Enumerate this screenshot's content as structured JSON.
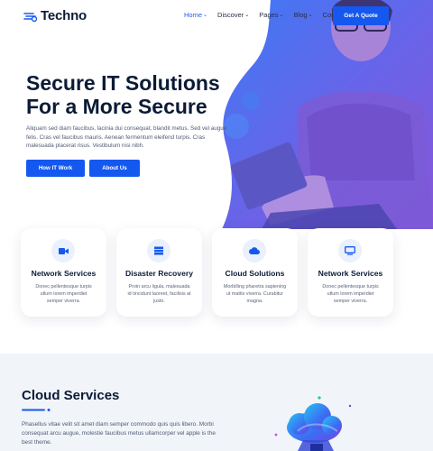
{
  "brand": {
    "name": "Techno",
    "accent": "#1558f0"
  },
  "nav": {
    "items": [
      {
        "label": "Home",
        "caret": "⌄",
        "active": true
      },
      {
        "label": "Discover",
        "caret": "⌄",
        "active": false
      },
      {
        "label": "Pages",
        "caret": "⌄",
        "active": false
      },
      {
        "label": "Blog",
        "caret": "⌄",
        "active": false
      },
      {
        "label": "Contact",
        "caret": "⌄",
        "active": false
      }
    ],
    "cta": "Get A Quote"
  },
  "hero": {
    "title_line1": "Secure IT Solutions",
    "title_line2": "For a More Secure",
    "description": "Aliquam sed diam faucibus, lacinia dui consequat, blandit metus. Sed vel augue felis. Cras vel faucibus mauris. Aenean fermentum eleifend turpis. Cras malesuada placerat risus. Vestibulum nisi nibh.",
    "buttons": {
      "primary": "How IT Work",
      "secondary": "About Us"
    }
  },
  "services": [
    {
      "icon": "video-camera-icon",
      "title": "Network Services",
      "text": "Donec pellentesque turpis utlum lorem imperdiet semper viverra."
    },
    {
      "icon": "server-icon",
      "title": "Disaster Recovery",
      "text": "Proin arcu ligula, malesuada id tincidunt laoreet, facilisis at justo."
    },
    {
      "icon": "cloud-icon",
      "title": "Cloud Solutions",
      "text": "Morbilling pharetra sapiening ut mattis viverra. Curabitur magna."
    },
    {
      "icon": "monitor-icon",
      "title": "Network Services",
      "text": "Donec pellentesque turpis utlum lorem imperdiet semper viverra."
    }
  ],
  "cloud_section": {
    "title": "Cloud Services",
    "description": "Phasellus vitae velit sit amet diam semper commodo quis quis libero. Morbi consequat arcu augue, molestie faucibus metus ullamcorper vel apple is the best theme."
  }
}
